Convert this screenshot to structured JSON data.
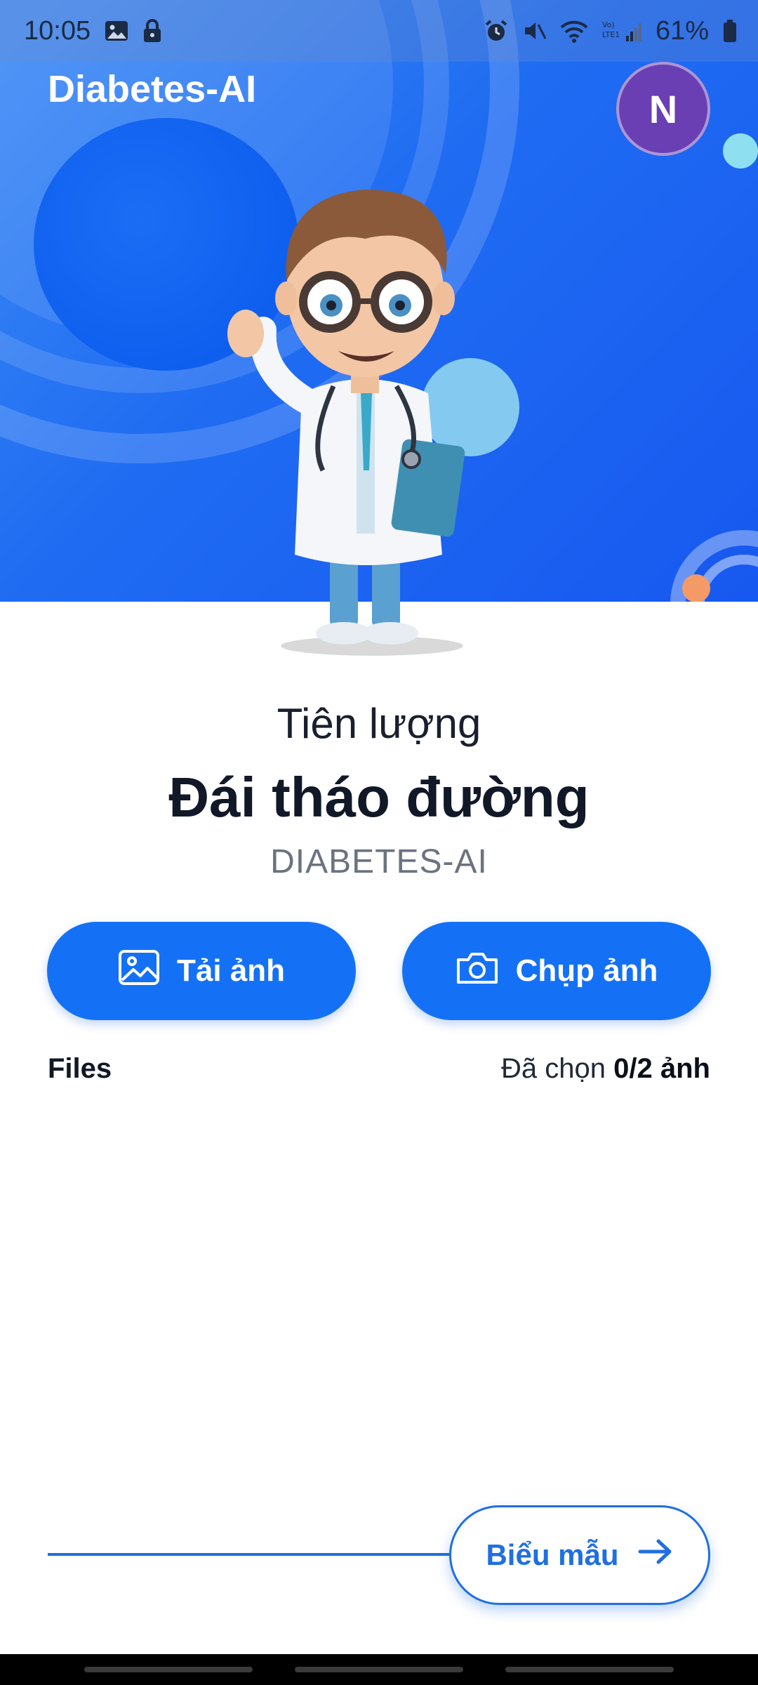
{
  "status_bar": {
    "time": "10:05",
    "battery": "61%"
  },
  "app_bar": {
    "title": "Diabetes-AI",
    "avatar_initial": "N"
  },
  "headline": {
    "line1": "Tiên lượng",
    "line2": "Đái tháo đường",
    "line3": "DIABETES-AI"
  },
  "actions": {
    "upload_label": "Tải ảnh",
    "camera_label": "Chụp ảnh"
  },
  "files": {
    "label": "Files",
    "selected_prefix": "Đã chọn ",
    "selected_count": "0/2 ảnh",
    "selected_fraction": 0
  },
  "footer": {
    "form_label": "Biểu mẫu"
  },
  "colors": {
    "primary": "#1471f5",
    "hero_blue": "#1f6cf2",
    "avatar_purple": "#6a3fb3",
    "outline_blue": "#1f6fe0"
  },
  "icons": [
    "image-status-icon",
    "lock-icon",
    "alarm-icon",
    "mute-icon",
    "wifi-icon",
    "signal-icon",
    "battery-icon",
    "image-upload-icon",
    "camera-icon",
    "arrow-right-icon"
  ]
}
